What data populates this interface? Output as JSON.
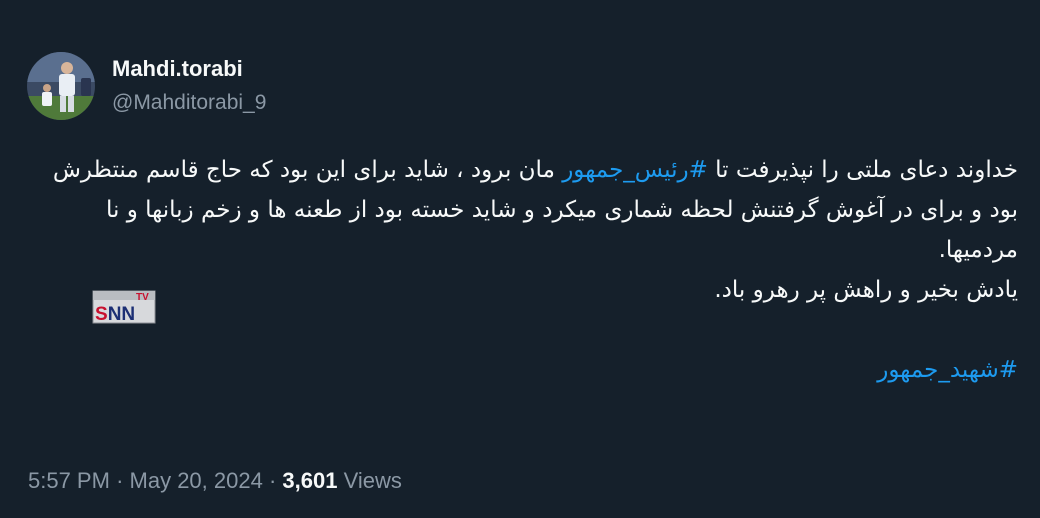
{
  "author": {
    "display_name": "Mahdi.torabi",
    "handle": "@Mahditorabi_9"
  },
  "tweet": {
    "text_before_tag": "خداوند دعای ملتی را نپذیرفت تا ",
    "hashtag_inline": "#رئیس_جمهور",
    "text_after_tag": " مان برود ، شاید برای این بود که حاج قاسم منتظرش بود و برای در آغوش گرفتنش لحظه شماری میکرد و شاید خسته بود از طعنه ها و زخم زبانها و نا مردمیها.",
    "line_last": "یادش بخیر و راهش پر رهرو باد.",
    "hashtag_footer": "#شهید_جمهور"
  },
  "watermark": {
    "text_top": "TV",
    "text_main": "SNN"
  },
  "meta": {
    "time": "5:57 PM",
    "separator": "·",
    "date": "May 20, 2024",
    "views_count": "3,601",
    "views_label": "Views"
  },
  "colors": {
    "background": "#15202b",
    "text": "#f7f9f9",
    "secondary": "#8b98a5",
    "link": "#1d9bf0"
  }
}
